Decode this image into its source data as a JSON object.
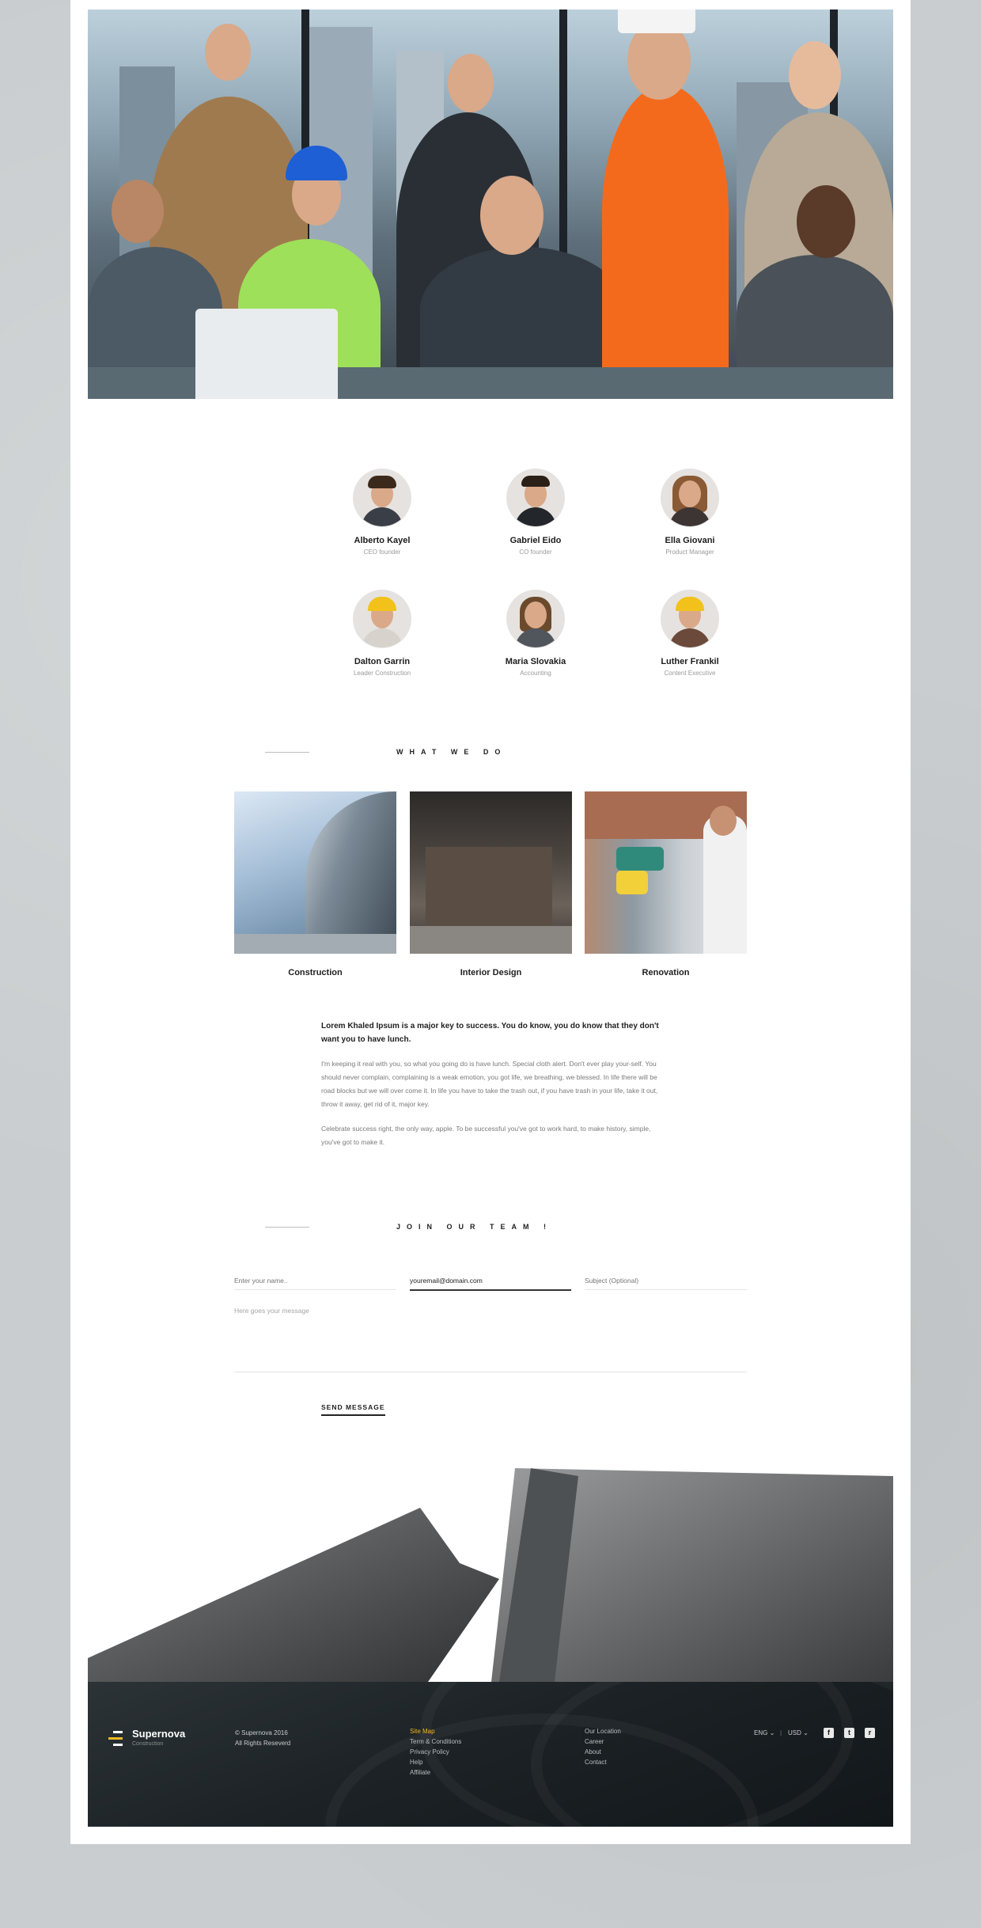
{
  "team": [
    {
      "name": "Alberto Kayel",
      "role": "CEO founder",
      "avatar": "male-suit"
    },
    {
      "name": "Gabriel Eido",
      "role": "CO founder",
      "avatar": "male-suit"
    },
    {
      "name": "Ella Giovani",
      "role": "Product Manager",
      "avatar": "female"
    },
    {
      "name": "Dalton Garrin",
      "role": "Leader Construction",
      "avatar": "male-hardhat"
    },
    {
      "name": "Maria Slovakia",
      "role": "Accounting",
      "avatar": "female"
    },
    {
      "name": "Luther Frankil",
      "role": "Content Executive",
      "avatar": "male-hardhat"
    }
  ],
  "what_we_do": {
    "title": "WHAT WE DO",
    "services": [
      {
        "label": "Construction",
        "image": "building-architecture"
      },
      {
        "label": "Interior Design",
        "image": "restaurant-interior"
      },
      {
        "label": "Renovation",
        "image": "worker-spray-painting"
      }
    ]
  },
  "about": {
    "lead": "Lorem Khaled Ipsum is a major key to success. You do know, you do know that they don't want you to have lunch.",
    "para1": "I'm keeping it real with you, so what you going do is have lunch. Special cloth alert. Don't ever play your-self. You should never complain, complaining is a weak emotion, you got life, we breathing, we blessed. In life there will be road blocks but we will over come it. In life you have to take the trash out, if you have trash in your life, take it out, throw it away, get rid of it, major key.",
    "para2": "Celebrate success right, the only way, apple. To be successful you've got to work hard, to make history, simple, you've got to make it."
  },
  "join": {
    "title": "JOIN OUR TEAM !",
    "name_placeholder": "Enter your name..",
    "email_value": "youremail@domain.com",
    "subject_placeholder": "Subject (Optional)",
    "message_placeholder": "Here goes your message",
    "send_label": "SEND MESSAGE"
  },
  "footer": {
    "brand": "Supernova",
    "brand_sub": "Construction",
    "copyright_line1": "© Supernova 2016",
    "copyright_line2": "All Rights Reseverd",
    "links_col1": [
      "Site Map",
      "Term & Conditions",
      "Privacy Policy",
      "Help",
      "Affiliate"
    ],
    "links_col2": [
      "Our Location",
      "Career",
      "About",
      "Contact"
    ],
    "language": "ENG",
    "currency": "USD",
    "social": [
      {
        "icon": "facebook-icon",
        "glyph": "f"
      },
      {
        "icon": "twitter-icon",
        "glyph": "t"
      },
      {
        "icon": "rss-icon",
        "glyph": "r"
      }
    ],
    "colors": {
      "highlight": "#f2b822",
      "background": "#1c2225"
    }
  }
}
